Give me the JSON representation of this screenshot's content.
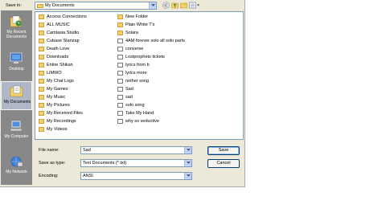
{
  "save_in": {
    "label": "Save in:",
    "value": "My Documents"
  },
  "places": [
    {
      "label": "My Recent Documents",
      "icon": "recent-documents-icon"
    },
    {
      "label": "Desktop",
      "icon": "desktop-icon"
    },
    {
      "label": "My Documents",
      "icon": "my-documents-icon"
    },
    {
      "label": "My Computer",
      "icon": "my-computer-icon"
    },
    {
      "label": "My Network",
      "icon": "my-network-icon"
    }
  ],
  "files_col1": [
    "Access Connections",
    "ALL MUSIC",
    "Camtasia Studio",
    "Cubase Stanzap",
    "Death Love",
    "Downloads",
    "Entire Shikan",
    "LIMWO",
    "My Chat Logs",
    "My Games",
    "My Music",
    "My Pictures",
    "My Received Files",
    "My Recordings",
    "My Videos"
  ],
  "files_col2": [
    {
      "name": "New Folder",
      "type": "folder"
    },
    {
      "name": "Plain White T's",
      "type": "folder"
    },
    {
      "name": "Solara",
      "type": "folder"
    },
    {
      "name": "4AM forever solo all solo parts",
      "type": "doc"
    },
    {
      "name": "converse",
      "type": "doc"
    },
    {
      "name": "Lostprophets tickets",
      "type": "doc"
    },
    {
      "name": "lyrics from b",
      "type": "doc"
    },
    {
      "name": "lyrics more",
      "type": "doc"
    },
    {
      "name": "nother song",
      "type": "doc"
    },
    {
      "name": "Sad",
      "type": "doc"
    },
    {
      "name": "sad",
      "type": "doc"
    },
    {
      "name": "solo song",
      "type": "doc"
    },
    {
      "name": "Take My Hand",
      "type": "doc"
    },
    {
      "name": "why so seductive",
      "type": "doc"
    }
  ],
  "file_name": {
    "label": "File name:",
    "value": "Sad"
  },
  "save_as_type": {
    "label": "Save as type:",
    "value": "Text Documents (*.txt)"
  },
  "encoding": {
    "label": "Encoding:",
    "value": "ANSI"
  },
  "buttons": {
    "save": "Save",
    "cancel": "Cancel"
  }
}
